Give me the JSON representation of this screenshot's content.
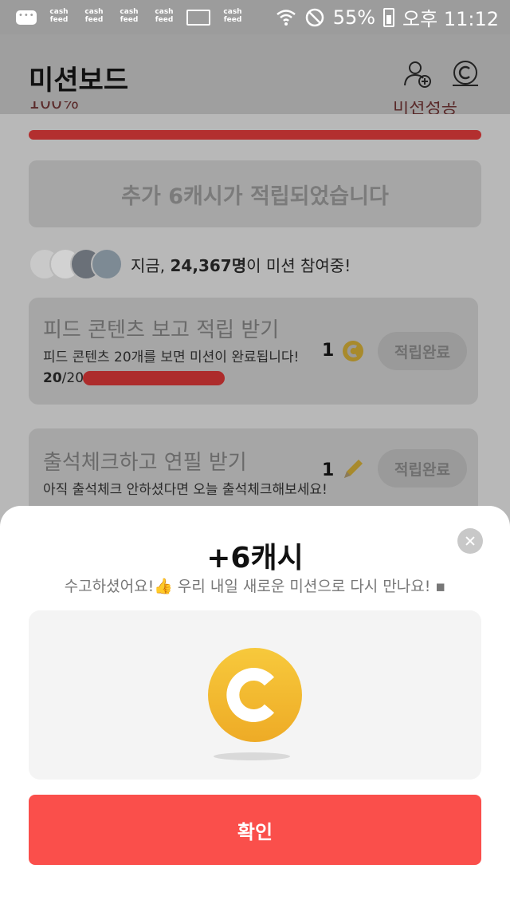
{
  "status_bar": {
    "app_icons": [
      "cash feed",
      "cash feed",
      "cash feed",
      "cash feed",
      "cash feed"
    ],
    "battery": "55%",
    "time": "오후 11:12"
  },
  "header": {
    "title": "미션보드"
  },
  "mission_progress": {
    "left_text": "100%",
    "right_text": "미션성공",
    "fill": 1.0
  },
  "bonus_banner": "추가 6캐시가 적립되었습니다",
  "participants": {
    "prefix": "지금, ",
    "count": "24,367명",
    "suffix": "이 미션 참여중!"
  },
  "missions": [
    {
      "title": "피드 콘텐츠 보고 적립 받기",
      "desc": "피드 콘텐츠 20개를 보면 미션이 완료됩니다!",
      "progress_done": "20",
      "progress_total": "/20",
      "reward": "1",
      "reward_icon": "coin-icon",
      "button": "적립완료"
    },
    {
      "title": "출석체크하고 연필 받기",
      "desc": "아직 출석체크 안하셨다면 오늘 출석체크해보세요!",
      "reward": "1",
      "reward_icon": "pencil-icon",
      "button": "적립완료"
    }
  ],
  "sheet": {
    "title": "+6캐시",
    "message": "수고하셨어요!👍 우리 내일 새로운 미션으로 다시 만나요! ▪",
    "confirm_label": "확인"
  },
  "colors": {
    "accent_red": "#fa4f4b",
    "coin_yellow": "#f5b72a"
  }
}
